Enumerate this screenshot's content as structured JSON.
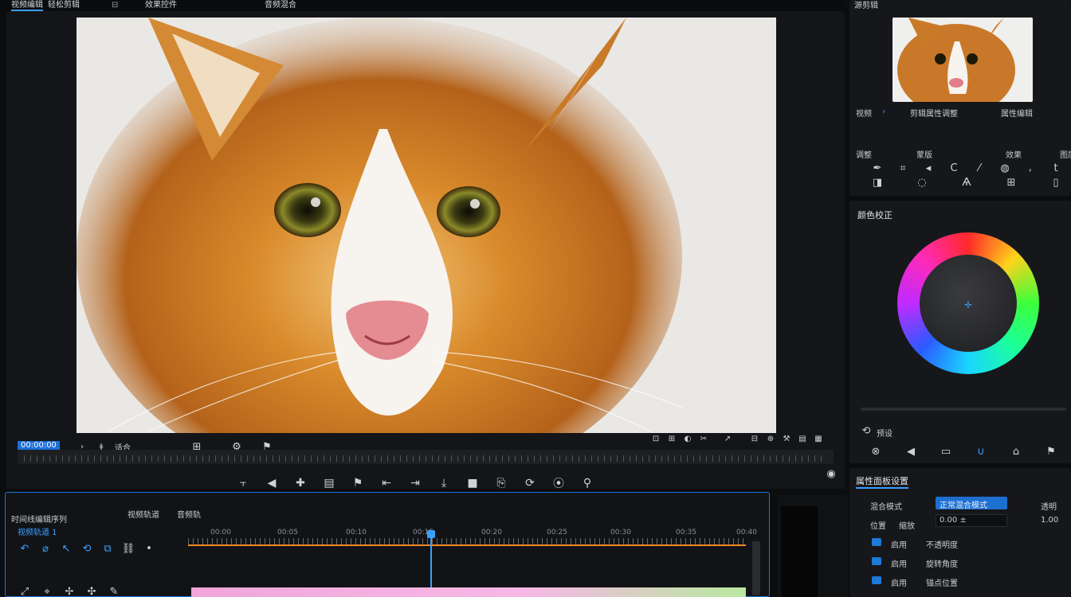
{
  "top_tabs": [
    "视频编辑",
    "轻松剪辑",
    "效果控件",
    "音频混合"
  ],
  "viewer": {
    "timecode": "00:00:00",
    "zoom": "适合",
    "controls": [
      "标记",
      "入点",
      "出点",
      "跳转",
      "播放",
      "跳转",
      "插入",
      "覆盖",
      "导出帧",
      "比较",
      "安全边距",
      "设置"
    ]
  },
  "right_panel": {
    "source_label": "源剪辑",
    "thumb_caption_left": "视频",
    "thumb_caption_mid": "剪辑属性调整",
    "thumb_caption_right": "属性编辑",
    "tools_label_1": "调整",
    "tools_label_2": "蒙版",
    "tools_label_3": "效果",
    "tools_label_4": "图层",
    "color_section_title": "颜色校正",
    "color_footer_label": "预设",
    "props_section_title": "属性面板设置",
    "props": [
      {
        "label": "混合模式",
        "value": "正常混合模式",
        "right": "透明"
      },
      {
        "label": "位置",
        "sub": "缩放",
        "value": "0.00 ±",
        "right": "1.00"
      }
    ],
    "toggles": [
      {
        "label": "启用",
        "value": "不透明度"
      },
      {
        "label": "启用",
        "value": "旋转角度"
      },
      {
        "label": "启用",
        "value": "锚点位置"
      }
    ]
  },
  "timeline": {
    "title": "时间线编辑序列",
    "subtitle": "视频轨道",
    "subtitle2": "音频轨",
    "track_label": "视频轨道 1",
    "ruler_marks": [
      "00:00",
      "00:05",
      "00:10",
      "00:15",
      "00:20",
      "00:25",
      "00:30",
      "00:35",
      "00:40"
    ]
  }
}
